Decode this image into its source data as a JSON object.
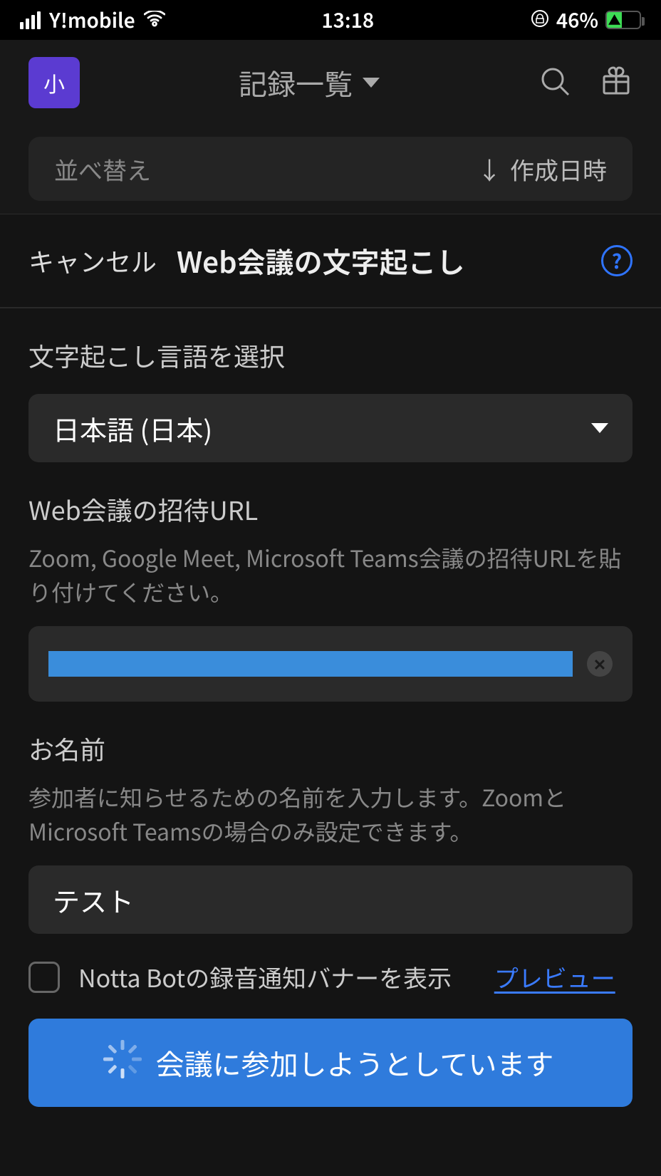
{
  "status_bar": {
    "carrier": "Y!mobile",
    "time": "13:18",
    "battery_percent": "46%"
  },
  "app_header": {
    "avatar_initial": "小",
    "title": "記録一覧"
  },
  "sort_bar": {
    "label": "並べ替え",
    "value": "作成日時"
  },
  "sheet": {
    "cancel": "キャンセル",
    "title": "Web会議の文字起こし",
    "language": {
      "label": "文字起こし言語を選択",
      "selected": "日本語 (日本)"
    },
    "url": {
      "label": "Web会議の招待URL",
      "desc": "Zoom, Google Meet, Microsoft Teams会議の招待URLを貼り付けてください。"
    },
    "name": {
      "label": "お名前",
      "desc": "参加者に知らせるための名前を入力します。ZoomとMicrosoft Teamsの場合のみ設定できます。",
      "value": "テスト"
    },
    "banner": {
      "label": "Notta Botの録音通知バナーを表示",
      "preview": "プレビュー"
    },
    "primary_button": "会議に参加しようとしています"
  }
}
